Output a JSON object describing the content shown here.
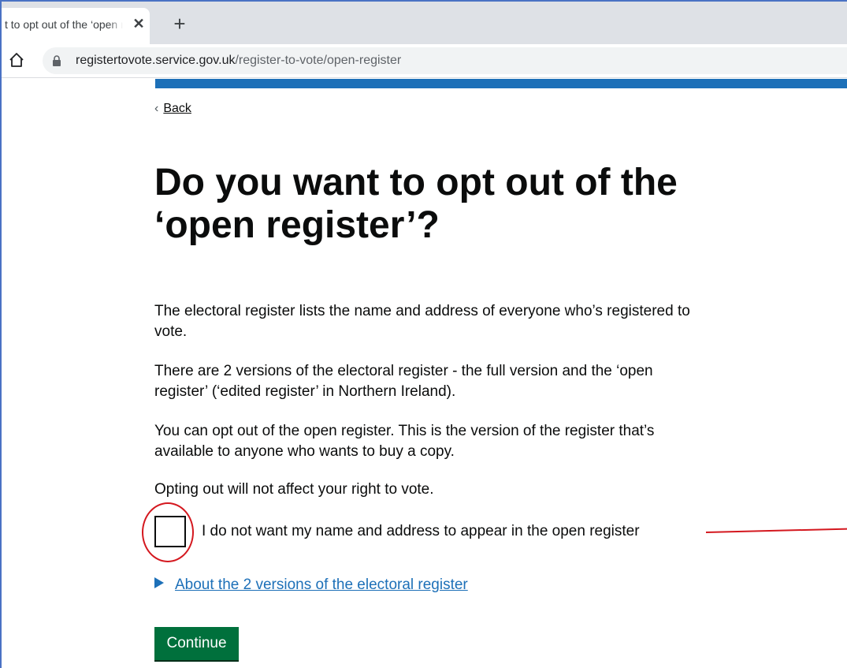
{
  "browser": {
    "tab_title": "t to opt out of the ‘open register’?",
    "tab_close_icon": "close-icon",
    "new_tab_icon": "plus-icon",
    "home_icon": "home-icon",
    "lock_icon": "lock-icon",
    "url_domain": "registertovote.service.gov.uk",
    "url_path": "/register-to-vote/open-register"
  },
  "page": {
    "back_label": "Back",
    "heading": "Do you want to opt out of the ‘open register’?",
    "paragraphs": [
      "The electoral register lists the name and address of everyone who’s registered to vote.",
      "There are 2 versions of the electoral register - the full version and the ‘open register’ (‘edited register’ in Northern Ireland).",
      "You can opt out of the open register. This is the version of the register that’s available to anyone who wants to buy a copy.",
      "Opting out will not affect your right to vote."
    ],
    "checkbox_label": "I do not want my name and address to appear in the open register",
    "checkbox_checked": false,
    "details_summary": "About the 2 versions of the electoral register",
    "continue_label": "Continue"
  },
  "colors": {
    "gov_blue": "#1d70b8",
    "button_green": "#00703c",
    "annotation_red": "#d4181f",
    "text": "#0b0c0c"
  }
}
